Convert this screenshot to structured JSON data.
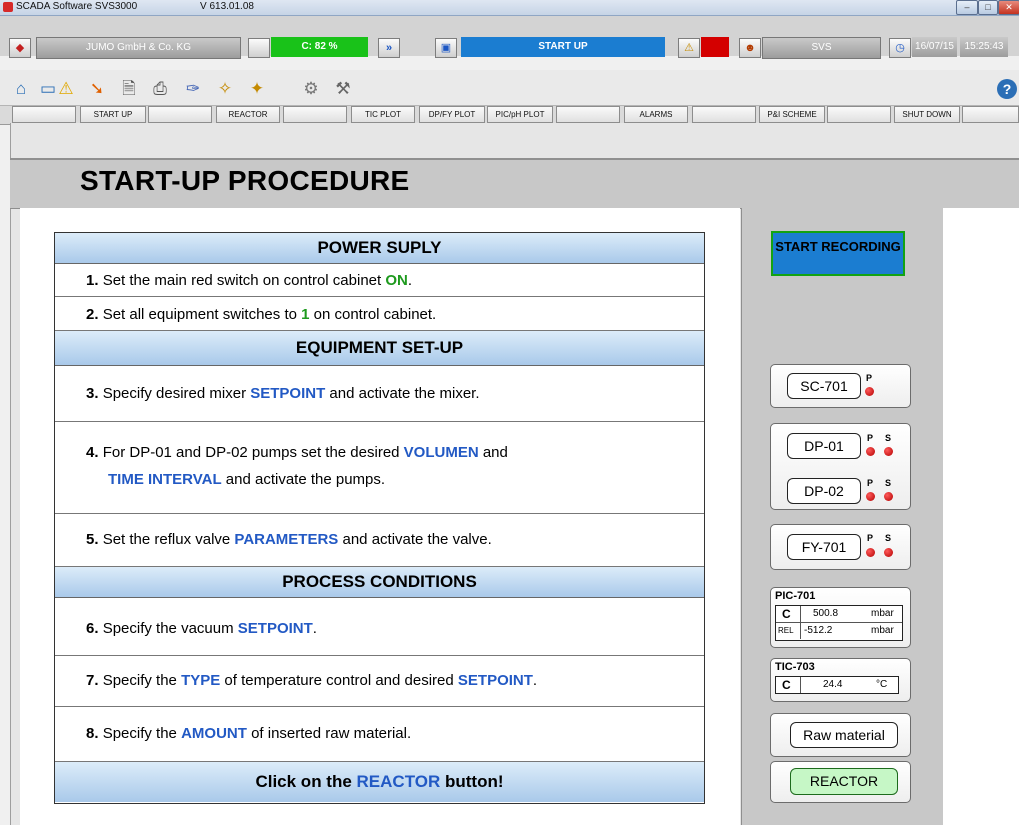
{
  "window": {
    "title": "SCADA Software SVS3000",
    "version": "V 613.01.08",
    "min_glyph": "–",
    "max_glyph": "□",
    "close_glyph": "✕"
  },
  "statusbar": {
    "company": "JUMO GmbH & Co. KG",
    "capacity": "C: 82 %",
    "mode": "START UP",
    "system": "SVS",
    "date": "16/07/15",
    "time": "15:25:43"
  },
  "nav": {
    "start_up": "START UP",
    "reactor": "REACTOR",
    "tic_plot": "TIC PLOT",
    "dp_fy_plot": "DP/FY PLOT",
    "pic_ph_plot": "PIC/pH PLOT",
    "alarms": "ALARMS",
    "pi_scheme": "P&I SCHEME",
    "shut_down": "SHUT DOWN"
  },
  "page": {
    "title": "START-UP PROCEDURE"
  },
  "sections": {
    "power": "POWER SUPLY",
    "equipment": "EQUIPMENT SET-UP",
    "process": "PROCESS CONDITIONS"
  },
  "steps": {
    "s1": {
      "num": "1.",
      "a": "Set the main red switch on control cabinet ",
      "hl": "ON",
      "b": "."
    },
    "s2": {
      "num": "2.",
      "a": "Set all equipment switches to ",
      "hl": "1",
      "b": " on control cabinet."
    },
    "s3": {
      "num": "3.",
      "a": "Specify desired mixer ",
      "hl": "SETPOINT",
      "b": " and activate the mixer."
    },
    "s4": {
      "num": "4.",
      "a": "For DP-01 and DP-02 pumps set the desired ",
      "hl": "VOLUMEN",
      "b": " and",
      "hl2": "TIME INTERVAL",
      "c": " and activate the pumps."
    },
    "s5": {
      "num": "5.",
      "a": "Set the reflux valve ",
      "hl": "PARAMETERS",
      "b": " and activate the valve."
    },
    "s6": {
      "num": "6.",
      "a": "Specify the vacuum ",
      "hl": "SETPOINT",
      "b": "."
    },
    "s7": {
      "num": "7.",
      "a": "Specify the ",
      "hl": "TYPE",
      "b": " of temperature control and desired ",
      "hl2": "SETPOINT",
      "c": "."
    },
    "s8": {
      "num": "8.",
      "a": "Specify the ",
      "hl": "AMOUNT",
      "b": " of inserted raw material."
    }
  },
  "footer": {
    "a": "Click on the ",
    "hl": "REACTOR",
    "b": " button!"
  },
  "side": {
    "start_recording": "START RECORDING",
    "sc701": "SC-701",
    "dp01": "DP-01",
    "dp02": "DP-02",
    "fy701": "FY-701",
    "p": "P",
    "s": "S",
    "pic701": {
      "title": "PIC-701",
      "c_label": "C",
      "c_value": "500.8",
      "c_unit": "mbar",
      "rel_label": "REL",
      "rel_value": "-512.2",
      "rel_unit": "mbar"
    },
    "tic703": {
      "title": "TIC-703",
      "c_label": "C",
      "value": "24.4",
      "unit": "°C"
    },
    "raw_material": "Raw material",
    "reactor": "REACTOR"
  },
  "icons": {
    "home": "⌂",
    "window": "▭",
    "warning": "⚠",
    "archive": "➘",
    "document": "🗎",
    "printer": "⎙",
    "tool": "✑",
    "wand": "✧",
    "wand_doc": "✦",
    "gear": "⚙",
    "settings": "⚒",
    "help": "?",
    "status_left": "◆",
    "arrows": "»",
    "screen": "▣",
    "alarm": "⚠",
    "users": "☻",
    "clock": "◷"
  },
  "colors": {
    "green_status": "#19c219",
    "blue_status": "#1b7dd1",
    "alarm_red": "#d40000",
    "highlight_blue": "#2259c4",
    "highlight_green": "#1e9a1e"
  }
}
